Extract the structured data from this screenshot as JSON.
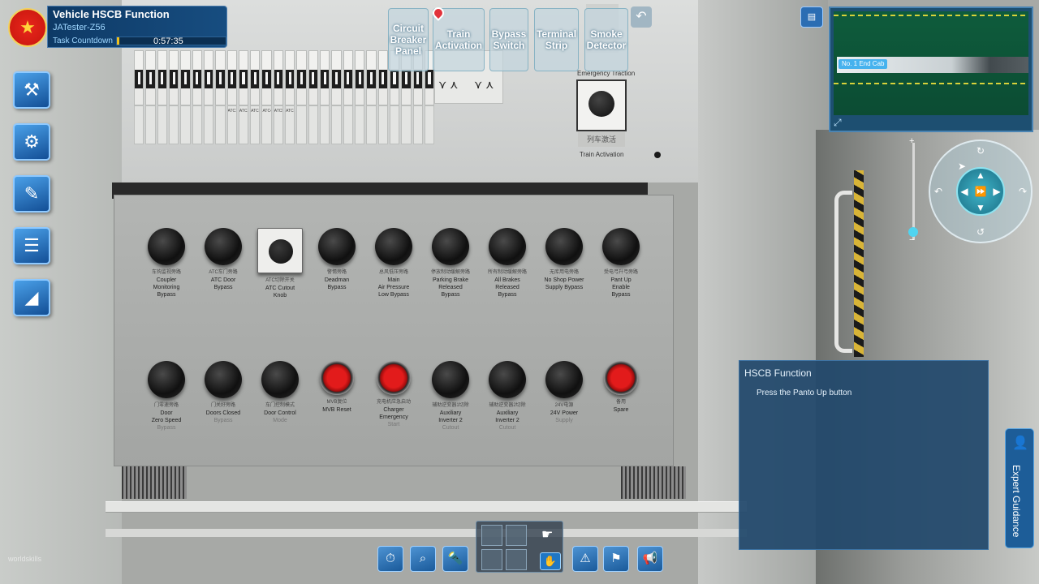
{
  "hud": {
    "title": "Vehicle HSCB Function",
    "user": "JATester-Z56",
    "countdown_label": "Task Countdown",
    "countdown_time": "0:57:35",
    "countdown_progress": 0.02
  },
  "flag": {
    "icon": "china-flag-icon",
    "glyph": "★"
  },
  "nav": {
    "buttons": [
      "Circuit Breaker Panel",
      "Train Activation",
      "Bypass Switch",
      "Terminal Strip",
      "Smoke Detector"
    ],
    "back": "↶"
  },
  "left_tools": [
    {
      "icon": "tools-icon",
      "glyph": "⚒"
    },
    {
      "icon": "meter-icon",
      "glyph": "⚙"
    },
    {
      "icon": "pencil-icon",
      "glyph": "✎"
    },
    {
      "icon": "checklist-icon",
      "glyph": "☰"
    },
    {
      "icon": "glasses-icon",
      "glyph": "◢"
    }
  ],
  "cabinet": {
    "breaker_labels": [
      "",
      "",
      "",
      "",
      "",
      "",
      "",
      "",
      "ATC1",
      "ATC2",
      "ATC3",
      "ATC4",
      "ATC5",
      "ATC6",
      "",
      "",
      "",
      "",
      "",
      "",
      "",
      "",
      "",
      "",
      "",
      ""
    ],
    "emergency_traction": "Emergency Traction",
    "train_activation": "Train Activation",
    "selector_tag": "列车激活"
  },
  "panel": {
    "row1": [
      {
        "cn": "车钩监视旁路",
        "en": [
          "Coupler",
          "Monitoring",
          "Bypass"
        ],
        "type": "knob"
      },
      {
        "cn": "ATC车门旁路",
        "en": [
          "ATC Door",
          "Bypass"
        ],
        "type": "knob"
      },
      {
        "cn": "ATC切除开关",
        "en": [
          "ATC Cutout",
          "Knob"
        ],
        "type": "mode"
      },
      {
        "cn": "警惕旁路",
        "en": [
          "Deadman",
          "Bypass"
        ],
        "type": "knob"
      },
      {
        "cn": "总风低压旁路",
        "en": [
          "Main",
          "Air Pressure",
          "Low Bypass"
        ],
        "type": "knob"
      },
      {
        "cn": "停放制动缓解旁路",
        "en": [
          "Parking Brake",
          "Released",
          "Bypass"
        ],
        "type": "knob"
      },
      {
        "cn": "所有制动缓解旁路",
        "en": [
          "All Brakes",
          "Released",
          "Bypass"
        ],
        "type": "knob"
      },
      {
        "cn": "无库用电旁路",
        "en": [
          "No Shop Power",
          "Supply Bypass"
        ],
        "type": "knob"
      },
      {
        "cn": "受电弓升弓旁路",
        "en": [
          "Pant Up",
          "Enable",
          "Bypass"
        ],
        "type": "knob"
      }
    ],
    "row2": [
      {
        "cn": "门零速旁路",
        "en": [
          "Door",
          "Zero Speed",
          "Bypass"
        ],
        "type": "knob"
      },
      {
        "cn": "门关好旁路",
        "en": [
          "Doors Closed",
          "Bypass"
        ],
        "type": "knob"
      },
      {
        "cn": "车门控制模式",
        "en": [
          "Door Control",
          "Mode"
        ],
        "type": "knob"
      },
      {
        "cn": "MVB复位",
        "en": [
          "MVB Reset"
        ],
        "type": "red"
      },
      {
        "cn": "充电机应急启动",
        "en": [
          "Charger",
          "Emergency",
          "Start"
        ],
        "type": "red"
      },
      {
        "cn": "辅助逆变器1切除",
        "en": [
          "Auxiliary",
          "Inverter 2",
          "Cutout"
        ],
        "type": "knob"
      },
      {
        "cn": "辅助逆变器2切除",
        "en": [
          "Auxiliary",
          "Inverter 2",
          "Cutout"
        ],
        "type": "knob"
      },
      {
        "cn": "24V电源",
        "en": [
          "24V Power",
          "Supply"
        ],
        "type": "knob"
      },
      {
        "cn": "备用",
        "en": [
          "Spare"
        ],
        "type": "red"
      }
    ]
  },
  "minimap": {
    "label": "No. 1 End Cab"
  },
  "guide": {
    "title": "HSCB Function",
    "instruction": "Press the Panto Up button"
  },
  "expert": {
    "label": "Expert Guidance"
  },
  "bottom_tools": [
    {
      "icon": "stopwatch-icon",
      "glyph": "⏱"
    },
    {
      "icon": "magnifier-icon",
      "glyph": "⌕"
    },
    {
      "icon": "flashlight-icon",
      "glyph": "🔦"
    },
    {
      "icon": "fault-x-icon",
      "glyph": "⚠"
    },
    {
      "icon": "inspect-icon",
      "glyph": "⚑"
    },
    {
      "icon": "broadcast-icon",
      "glyph": "📢"
    }
  ],
  "watermark": "worldskills"
}
